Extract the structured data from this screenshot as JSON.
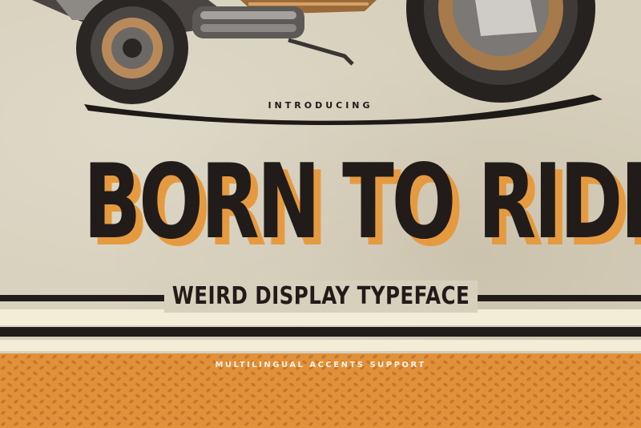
{
  "kicker": "INTRODUCING",
  "headline": "BORN TO RIDE",
  "subtitle": "WEIRD DISPLAY TYPEFACE",
  "support_text": "MULTILINGUAL ACCENTS SUPPORT",
  "colors": {
    "paper": "#d7d0bc",
    "ink": "#211c19",
    "accent_orange": "#e69a40",
    "cream": "#f3ecd6",
    "pattern_orange": "#e1913a"
  },
  "icons": [
    "motorcycle-illustration"
  ]
}
